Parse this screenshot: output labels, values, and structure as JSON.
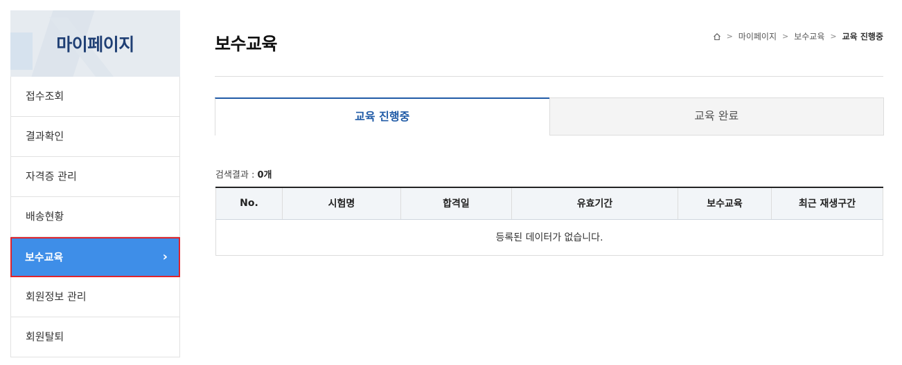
{
  "sidebar": {
    "title": "마이페이지",
    "items": [
      {
        "label": "접수조회"
      },
      {
        "label": "결과확인"
      },
      {
        "label": "자격증 관리"
      },
      {
        "label": "배송현황"
      },
      {
        "label": "보수교육",
        "active": true
      },
      {
        "label": "회원정보 관리"
      },
      {
        "label": "회원탈퇴"
      }
    ]
  },
  "header": {
    "title": "보수교육",
    "breadcrumb": [
      "마이페이지",
      "보수교육",
      "교육 진행중"
    ]
  },
  "tabs": [
    {
      "label": "교육 진행중",
      "active": true
    },
    {
      "label": "교육 완료",
      "active": false
    }
  ],
  "result": {
    "label": "검색결과 : ",
    "count": "0개"
  },
  "table": {
    "columns": [
      "No.",
      "시험명",
      "합격일",
      "유효기간",
      "보수교육",
      "최근 재생구간"
    ],
    "empty_message": "등록된 데이터가 없습니다."
  },
  "colors": {
    "accent": "#1f5aa6",
    "active_menu": "#3e8ee8",
    "highlight_border": "#e0232b"
  }
}
